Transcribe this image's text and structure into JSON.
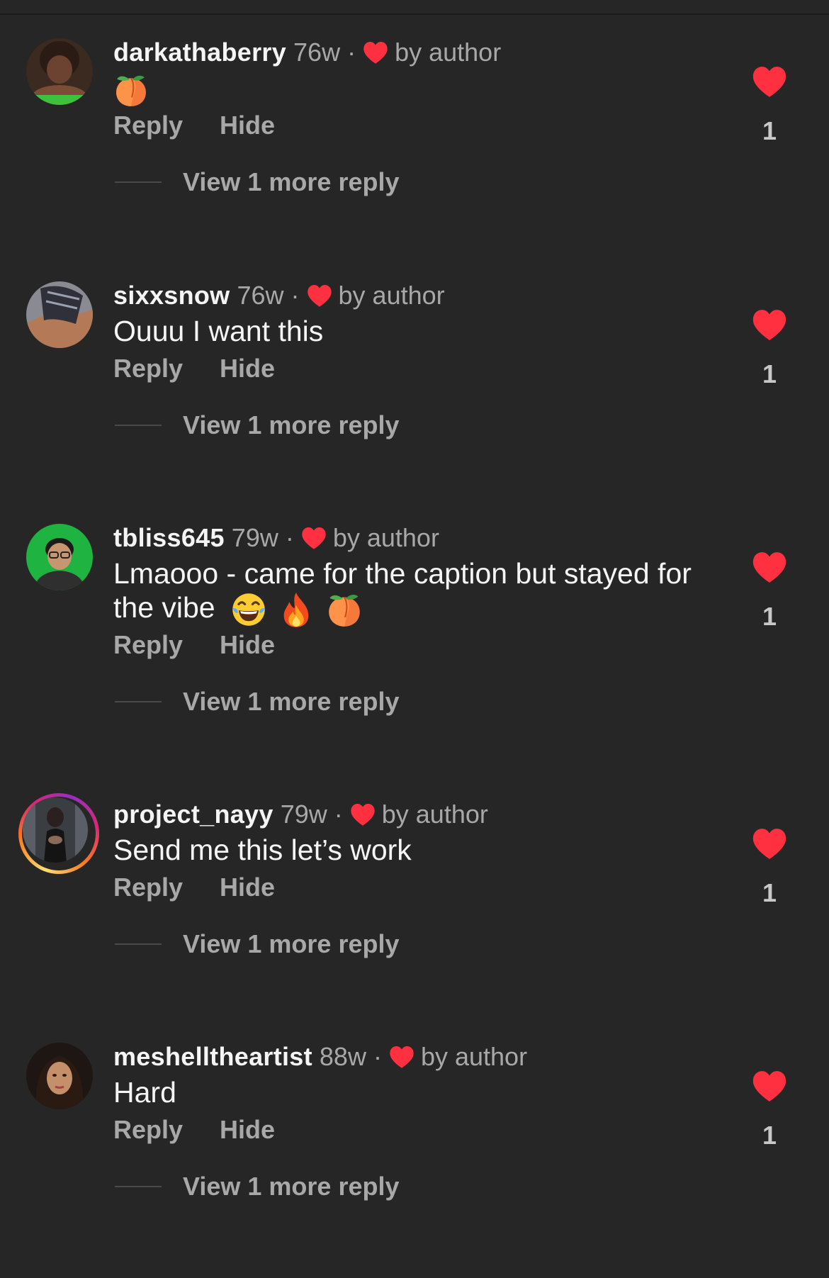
{
  "colors": {
    "background": "#262626",
    "heart": "#ff3040",
    "secondary_text": "#a8a8a8"
  },
  "comments": [
    {
      "username": "darkathaberry",
      "time": "76w",
      "dot": "·",
      "by_author": "by author",
      "text": "",
      "emojis": [
        "peach"
      ],
      "reply_label": "Reply",
      "hide_label": "Hide",
      "view_more": "View 1 more reply",
      "likes": "1",
      "avatar": "avatar-photo"
    },
    {
      "username": "sixxsnow",
      "time": "76w",
      "dot": "·",
      "by_author": "by author",
      "text": "Ouuu I want this",
      "reply_label": "Reply",
      "hide_label": "Hide",
      "view_more": "View 1 more reply",
      "likes": "1",
      "avatar": "avatar-photo"
    },
    {
      "username": "tbliss645",
      "time": "79w",
      "dot": "·",
      "by_author": "by author",
      "text": "Lmaooo - came for the caption but stayed for the vibe",
      "emojis": [
        "face-with-tears-of-joy",
        "fire",
        "peach"
      ],
      "reply_label": "Reply",
      "hide_label": "Hide",
      "view_more": "View 1 more reply",
      "likes": "1",
      "avatar": "avatar-photo"
    },
    {
      "username": "project_nayy",
      "time": "79w",
      "dot": "·",
      "by_author": "by author",
      "text": "Send me this let’s work",
      "reply_label": "Reply",
      "hide_label": "Hide",
      "view_more": "View 1 more reply",
      "likes": "1",
      "avatar": "avatar-photo-story-ring"
    },
    {
      "username": "meshelltheartist",
      "time": "88w",
      "dot": "·",
      "by_author": "by author",
      "text": "Hard",
      "reply_label": "Reply",
      "hide_label": "Hide",
      "view_more": "View 1 more reply",
      "likes": "1",
      "avatar": "avatar-photo"
    }
  ]
}
